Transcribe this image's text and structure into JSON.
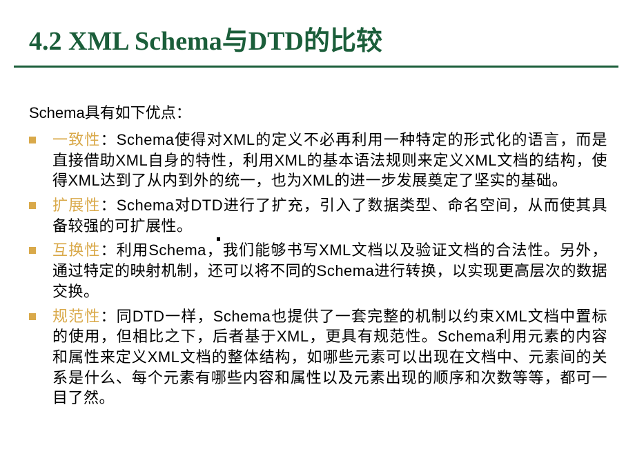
{
  "title": "4.2  XML Schema与DTD的比较",
  "intro": "Schema具有如下优点：",
  "bullets": [
    {
      "label": "一致性",
      "text": "：Schema使得对XML的定义不必再利用一种特定的形式化的语言，而是直接借助XML自身的特性，利用XML的基本语法规则来定义XML文档的结构，使得XML达到了从内到外的统一，也为XML的进一步发展奠定了坚实的基础。"
    },
    {
      "label": "扩展性",
      "text": "：Schema对DTD进行了扩充，引入了数据类型、命名空间，从而使其具备较强的可扩展性。"
    },
    {
      "label": "互换性",
      "text": "：利用Schema，我们能够书写XML文档以及验证文档的合法性。另外，通过特定的映射机制，还可以将不同的Schema进行转换，以实现更高层次的数据交换。"
    },
    {
      "label": "规范性",
      "text": "：同DTD一样，Schema也提供了一套完整的机制以约束XML文档中置标的使用，但相比之下，后者基于XML，更具有规范性。Schema利用元素的内容和属性来定义XML文档的整体结构，如哪些元素可以出现在文档中、元素间的关系是什么、每个元素有哪些内容和属性以及元素出现的顺序和次数等等，都可一目了然。"
    }
  ]
}
